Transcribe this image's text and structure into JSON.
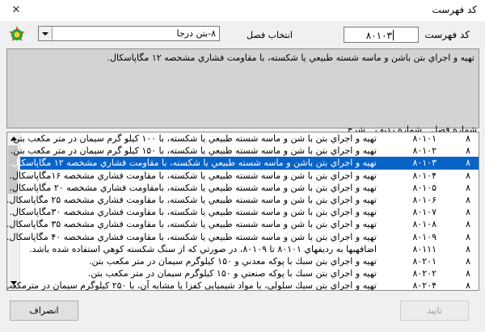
{
  "window": {
    "title": "کد فهرست",
    "close_label": "✕"
  },
  "section_select": {
    "label": "انتخاب فصل",
    "value": "۸-بتن درجا"
  },
  "code_field": {
    "label": "کد فهرست",
    "value": "۸۰۱۰۳"
  },
  "description": "تهيه و اجراي بتن باشن و ماسه شسته طبيعي يا شكسته، با مقاومت فشاري مشخصه ۱۲ مگاپاسكال.",
  "list": {
    "headers": {
      "section": "شماره فصل",
      "code": "شماره رديف",
      "desc": "شرح"
    },
    "selected_index": 2,
    "rows": [
      {
        "section": "۸",
        "code": "۸۰۱۰۱",
        "desc": "تهيه و اجراي بتن با شن و ماسه شسته طبيعي يا شكسته، با ۱۰۰ كيلو گرم سيمان در متر مكعب بتن."
      },
      {
        "section": "۸",
        "code": "۸۰۱۰۲",
        "desc": "تهيه و اجراي بتن با شن و ماسه شسته طبيعي يا شكسته، با ۱۵۰ كيلو گرم سيمان در متر مكعب بتن."
      },
      {
        "section": "۸",
        "code": "۸۰۱۰۳",
        "desc": "تهيه و اجراي بتن باشن و ماسه شسته طبيعي يا شكسته، با مقاومت فشاري مشخصه ۱۲ مگاپاسكال."
      },
      {
        "section": "۸",
        "code": "۸۰۱۰۴",
        "desc": "تهيه و اجراي بتن با شن و ماسه شسته طبيعي يا شكسته، با مقاومت فشاري مشخصه ۱۶مگاپاسكال."
      },
      {
        "section": "۸",
        "code": "۸۰۱۰۵",
        "desc": "تهيه و اجراي بتن با شن و ماسه شسته طبيعي يا شكسته، بامقاومت فشاري مشخصه ۲۰ مگاپاسكال."
      },
      {
        "section": "۸",
        "code": "۸۰۱۰۶",
        "desc": "تهيه و اجراي بتن با شن و ماسه شسته طبيعي يا شكسته، با مقاومت فشاري مشخصه ۲۵ مگاپاسكال."
      },
      {
        "section": "۸",
        "code": "۸۰۱۰۷",
        "desc": "تهيه و اجراي بتن با شن و ماسه شسته طبيعي يا شكسته، با مقاومت فشاري مشخصه ۳۰مگاپاسكال."
      },
      {
        "section": "۸",
        "code": "۸۰۱۰۸",
        "desc": "تهيه و اجراي بتن با شن و ماسه شسته طبيعي يا شكسته، با مقاومت فشاري مشخصه ۳۵ مگاپاسكال."
      },
      {
        "section": "۸",
        "code": "۸۰۱۰۹",
        "desc": "تهيه و اجراي بتن با شن و ماسه شسته طبيعي يا شكسته، با مقاومت فشاري مشخصه ۴۰ مگاپاسكال."
      },
      {
        "section": "۸",
        "code": "۸۰۱۱۱",
        "desc": "اضافهبها به رديفهاي ۸۰۱۰۱ تا ۸۰۱۰۹، در صورتي كه از سنگ شكسته كوهي استفاده شده باشد."
      },
      {
        "section": "۸",
        "code": "۸۰۲۰۱",
        "desc": "تهيه و اجراي بتن سبك با پوكه معدني و ۱۵۰ كيلوگرم سيمان در متر مكعب بتن."
      },
      {
        "section": "۸",
        "code": "۸۰۲۰۲",
        "desc": "تهيه و اجراي بتن سبك با پوكه صنعتي و ۱۵۰ كيلوگرم سيمان در متر مكعب بتن."
      },
      {
        "section": "۸",
        "code": "۸۰۲۰۴",
        "desc": "تهيه و اجراي بتن سبك سلولي، با مواد شيميايي كفزا يا مشابه آن، با ۲۵۰ كيلوگرم سيمان در مترمكعب بتن."
      }
    ]
  },
  "buttons": {
    "ok": "تاييد",
    "cancel": "انصراف"
  },
  "colors": {
    "selection": "#0a64c8",
    "description_bg": "#d3d3d3",
    "dialog_bg": "#f0f0f0"
  }
}
